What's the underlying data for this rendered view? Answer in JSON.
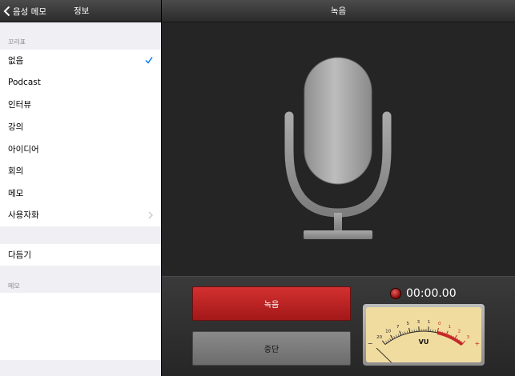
{
  "left_panel": {
    "back_label": "음성 메모",
    "title": "정보",
    "tags_label": "꼬리표",
    "tags": [
      {
        "label": "없음",
        "selected": true
      },
      {
        "label": "Podcast"
      },
      {
        "label": "인터뷰"
      },
      {
        "label": "강의"
      },
      {
        "label": "아이디어"
      },
      {
        "label": "회의"
      },
      {
        "label": "메모"
      },
      {
        "label": "사용자화",
        "has_disclosure": true
      }
    ],
    "trim_label": "다듬기",
    "memo_label": "메모"
  },
  "right_panel": {
    "title": "녹음",
    "record_label": "녹음",
    "stop_label": "중단",
    "timer": "00:00.00",
    "vu_label": "VU",
    "vu_scale": [
      "20",
      "10",
      "7",
      "5",
      "3",
      "1",
      "0",
      "1",
      "2",
      "3"
    ],
    "vu_minus": "−",
    "vu_plus": "+",
    "vu_level": 0
  },
  "colors": {
    "accent": "#007aff",
    "record_red": "#c62828",
    "vu_face": "#f1dca0"
  }
}
